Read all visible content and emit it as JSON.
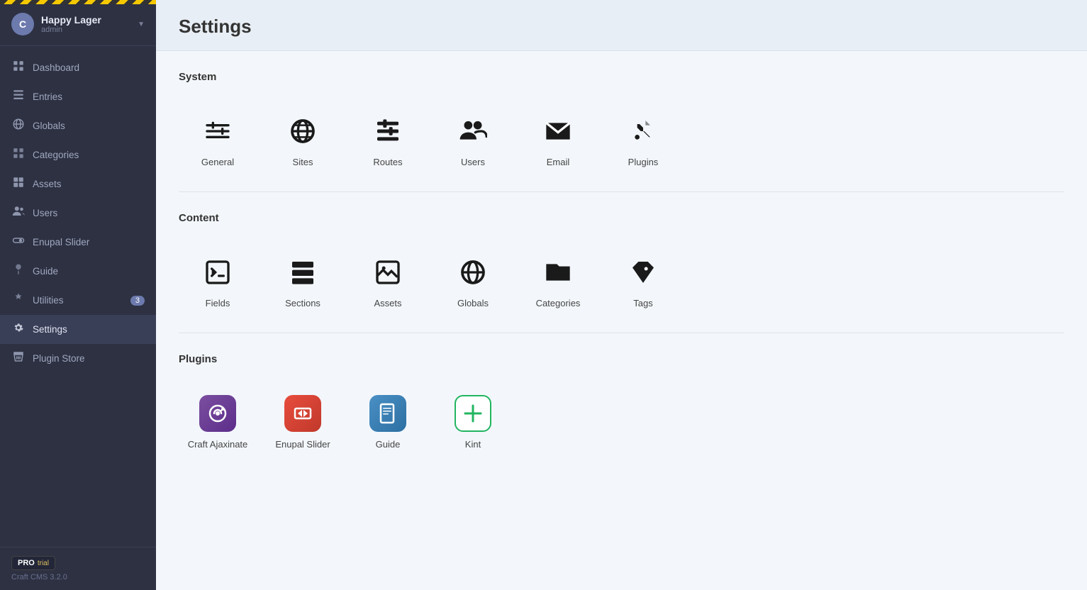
{
  "brand": {
    "initial": "C",
    "name": "Happy Lager",
    "role": "admin"
  },
  "sidebar": {
    "items": [
      {
        "label": "Dashboard",
        "icon": "dashboard",
        "active": false,
        "badge": null
      },
      {
        "label": "Entries",
        "icon": "entries",
        "active": false,
        "badge": null
      },
      {
        "label": "Globals",
        "icon": "globals",
        "active": false,
        "badge": null
      },
      {
        "label": "Categories",
        "icon": "categories",
        "active": false,
        "badge": null
      },
      {
        "label": "Assets",
        "icon": "assets",
        "active": false,
        "badge": null
      },
      {
        "label": "Users",
        "icon": "users",
        "active": false,
        "badge": null
      },
      {
        "label": "Enupal Slider",
        "icon": "enupal",
        "active": false,
        "badge": null
      },
      {
        "label": "Guide",
        "icon": "guide",
        "active": false,
        "badge": null
      },
      {
        "label": "Utilities",
        "icon": "utilities",
        "active": false,
        "badge": "3"
      },
      {
        "label": "Settings",
        "icon": "settings",
        "active": true,
        "badge": null
      },
      {
        "label": "Plugin Store",
        "icon": "plugin-store",
        "active": false,
        "badge": null
      }
    ]
  },
  "footer": {
    "pro_label": "PRO",
    "trial_label": "trial",
    "version": "Craft CMS 3.2.0"
  },
  "page": {
    "title": "Settings"
  },
  "sections": [
    {
      "title": "System",
      "items": [
        {
          "label": "General",
          "icon": "general"
        },
        {
          "label": "Sites",
          "icon": "sites"
        },
        {
          "label": "Routes",
          "icon": "routes"
        },
        {
          "label": "Users",
          "icon": "users"
        },
        {
          "label": "Email",
          "icon": "email"
        },
        {
          "label": "Plugins",
          "icon": "plugins"
        }
      ]
    },
    {
      "title": "Content",
      "items": [
        {
          "label": "Fields",
          "icon": "fields"
        },
        {
          "label": "Sections",
          "icon": "sections"
        },
        {
          "label": "Assets",
          "icon": "assets"
        },
        {
          "label": "Globals",
          "icon": "globals"
        },
        {
          "label": "Categories",
          "icon": "categories"
        },
        {
          "label": "Tags",
          "icon": "tags"
        }
      ]
    },
    {
      "title": "Plugins",
      "items": [
        {
          "label": "Craft Ajaxinate",
          "icon": "craft-ajaxinate"
        },
        {
          "label": "Enupal Slider",
          "icon": "enupal-slider"
        },
        {
          "label": "Guide",
          "icon": "guide-plugin"
        },
        {
          "label": "Kint",
          "icon": "kint"
        }
      ]
    }
  ]
}
